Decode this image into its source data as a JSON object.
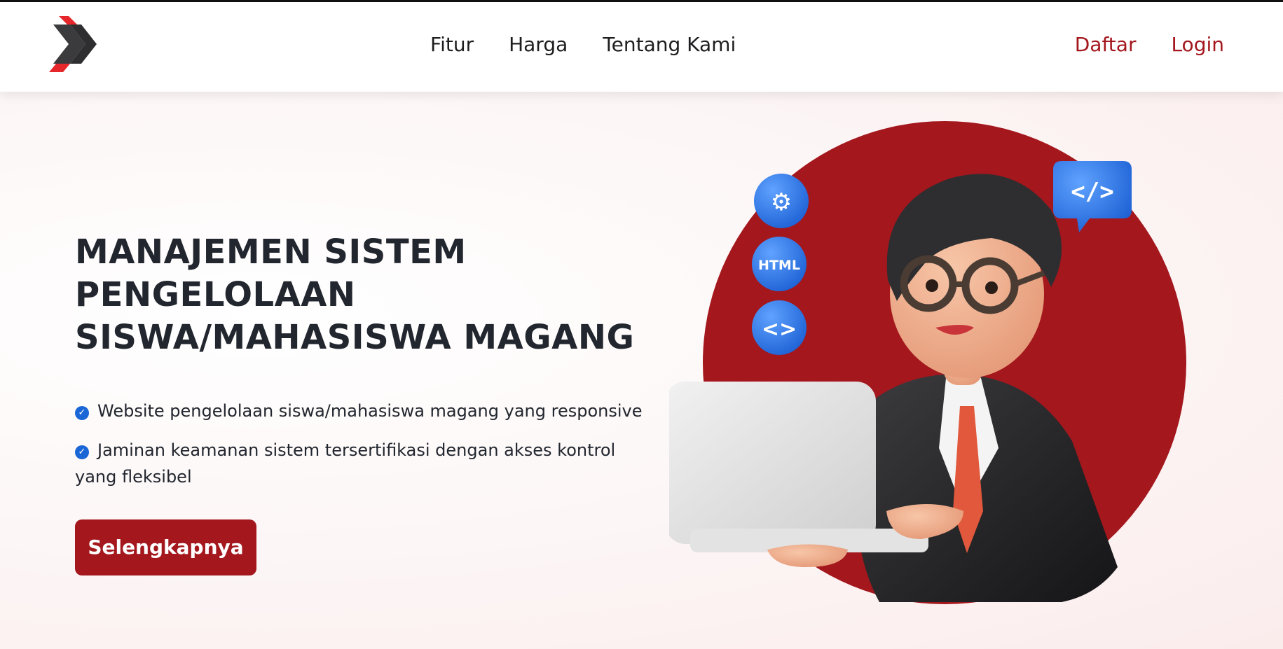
{
  "nav": {
    "links": [
      "Fitur",
      "Harga",
      "Tentang Kami"
    ],
    "auth": {
      "register": "Daftar",
      "login": "Login"
    }
  },
  "hero": {
    "title_lines": [
      "MANAJEMEN SISTEM",
      "PENGELOLAAN",
      "SISWA/MAHASISWA MAGANG"
    ],
    "features": [
      "Website pengelolaan siswa/mahasiswa magang yang responsive",
      "Jaminan keamanan sistem tersertifikasi dengan akses kontrol yang fleksibel"
    ],
    "cta_label": "Selengkapnya"
  },
  "illustration": {
    "badges": [
      "gears-icon",
      "HTML",
      "<>"
    ],
    "speech_bubble": "</>"
  },
  "colors": {
    "brand_red": "#a3171d",
    "check_blue": "#1a66d6",
    "text_dark": "#22262e"
  }
}
